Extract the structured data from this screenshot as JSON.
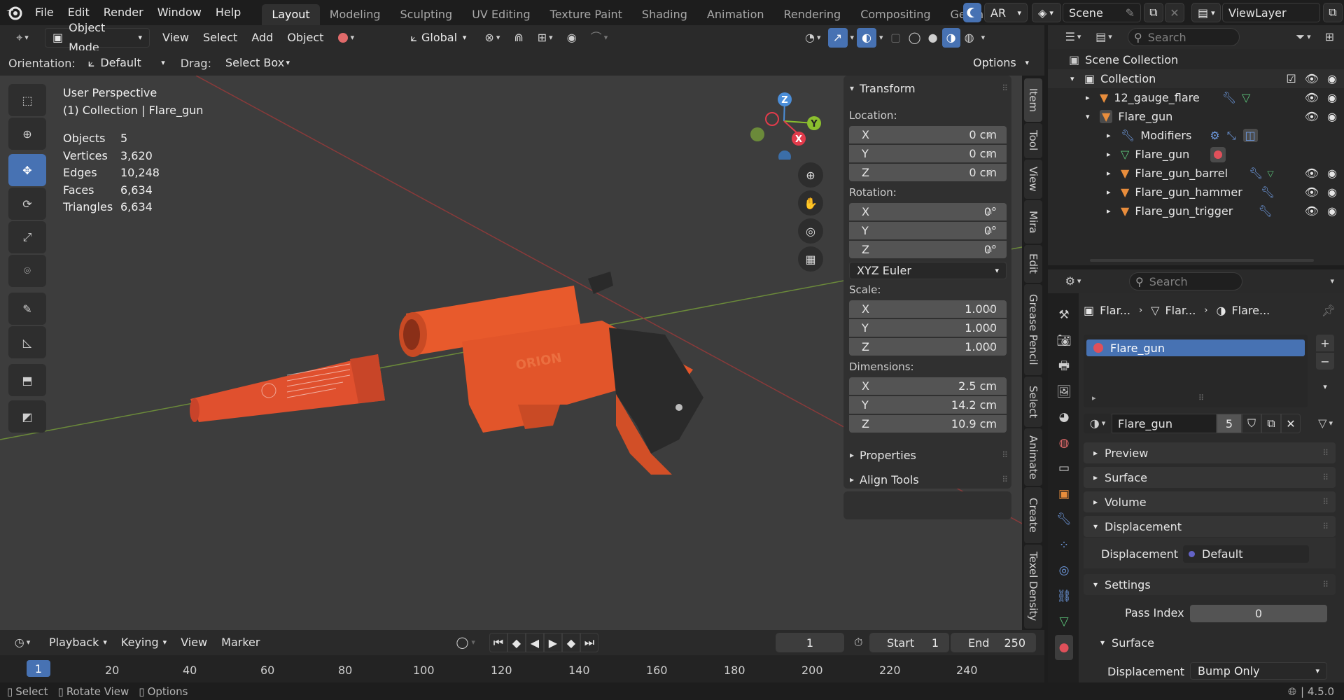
{
  "top_menu": [
    "File",
    "Edit",
    "Render",
    "Window",
    "Help"
  ],
  "workspace_tabs": [
    "Layout",
    "Modeling",
    "Sculpting",
    "UV Editing",
    "Texture Paint",
    "Shading",
    "Animation",
    "Rendering",
    "Compositing",
    "Geome"
  ],
  "active_workspace": "Layout",
  "top_right": {
    "ar_label": "AR",
    "scene_label": "Scene",
    "view_layer_label": "ViewLayer"
  },
  "viewport_header": {
    "mode": "Object Mode",
    "menus": [
      "View",
      "Select",
      "Add",
      "Object"
    ],
    "transform_orientation": "Global"
  },
  "tool_settings": {
    "orientation_label": "Orientation:",
    "orientation_value": "Default",
    "drag_label": "Drag:",
    "drag_value": "Select Box",
    "options_label": "Options"
  },
  "viewport_info": {
    "perspective": "User Perspective",
    "collection_line": "(1) Collection | Flare_gun",
    "stats": [
      {
        "label": "Objects",
        "value": "5"
      },
      {
        "label": "Vertices",
        "value": "3,620"
      },
      {
        "label": "Edges",
        "value": "10,248"
      },
      {
        "label": "Faces",
        "value": "6,634"
      },
      {
        "label": "Triangles",
        "value": "6,634"
      }
    ]
  },
  "gizmo": {
    "z": "Z",
    "y": "Y",
    "x": "X"
  },
  "npanel": {
    "transform_title": "Transform",
    "location_label": "Location:",
    "location": [
      {
        "axis": "X",
        "value": "0 cm"
      },
      {
        "axis": "Y",
        "value": "0 cm"
      },
      {
        "axis": "Z",
        "value": "0 cm"
      }
    ],
    "rotation_label": "Rotation:",
    "rotation": [
      {
        "axis": "X",
        "value": "0°"
      },
      {
        "axis": "Y",
        "value": "0°"
      },
      {
        "axis": "Z",
        "value": "0°"
      }
    ],
    "rotation_mode": "XYZ Euler",
    "scale_label": "Scale:",
    "scale": [
      {
        "axis": "X",
        "value": "1.000"
      },
      {
        "axis": "Y",
        "value": "1.000"
      },
      {
        "axis": "Z",
        "value": "1.000"
      }
    ],
    "dimensions_label": "Dimensions:",
    "dimensions": [
      {
        "axis": "X",
        "value": "2.5 cm"
      },
      {
        "axis": "Y",
        "value": "14.2 cm"
      },
      {
        "axis": "Z",
        "value": "10.9 cm"
      }
    ],
    "properties_label": "Properties",
    "align_tools_label": "Align Tools"
  },
  "side_tabs": [
    "Item",
    "Tool",
    "View",
    "Mira",
    "Edit",
    "Grease Pencil",
    "Select",
    "Animate",
    "Create",
    "Texel Density"
  ],
  "outliner": {
    "search_placeholder": "Search",
    "rows": [
      {
        "label": "Scene Collection",
        "indent": 0
      },
      {
        "label": "Collection",
        "indent": 1
      },
      {
        "label": "12_gauge_flare",
        "indent": 2
      },
      {
        "label": "Flare_gun",
        "indent": 2
      },
      {
        "label": "Modifiers",
        "indent": 3
      },
      {
        "label": "Flare_gun",
        "indent": 3
      },
      {
        "label": "Flare_gun_barrel",
        "indent": 3
      },
      {
        "label": "Flare_gun_hammer",
        "indent": 3
      },
      {
        "label": "Flare_gun_trigger",
        "indent": 3
      }
    ]
  },
  "properties": {
    "search_placeholder": "Search",
    "breadcrumb": [
      "Flar...",
      "Flar...",
      "Flare..."
    ],
    "material_slot": "Flare_gun",
    "material_name": "Flare_gun",
    "material_users": "5",
    "sections": [
      "Preview",
      "Surface",
      "Volume",
      "Displacement"
    ],
    "displacement_label": "Displacement",
    "displacement_value": "Default",
    "settings_label": "Settings",
    "pass_index_label": "Pass Index",
    "pass_index_value": "0",
    "surface_sub_label": "Surface",
    "displacement_method_label": "Displacement",
    "displacement_method_value": "Bump Only"
  },
  "timeline": {
    "menus": [
      "Playback",
      "Keying",
      "View",
      "Marker"
    ],
    "current_frame": "1",
    "start_label": "Start",
    "start_value": "1",
    "end_label": "End",
    "end_value": "250",
    "ticks": [
      "1",
      "20",
      "40",
      "60",
      "80",
      "100",
      "120",
      "140",
      "160",
      "180",
      "200",
      "220",
      "240"
    ]
  },
  "status_bar": {
    "items": [
      "Select",
      "Rotate View",
      "Options"
    ],
    "version": "4.5.0"
  }
}
